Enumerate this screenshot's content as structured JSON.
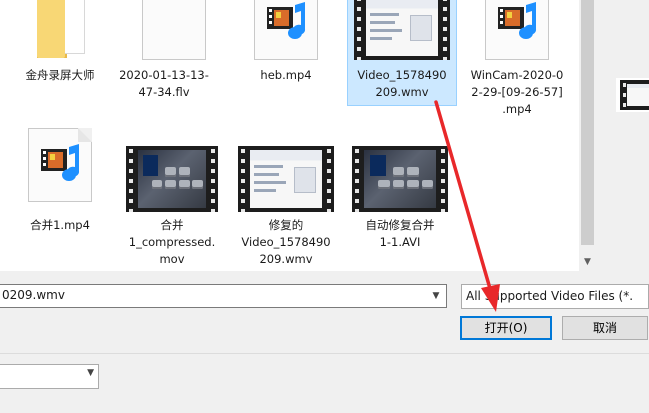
{
  "files": [
    {
      "name": "金舟录屏大师",
      "kind": "folder",
      "selected": false
    },
    {
      "name": "2020-01-13-13-\n47-34.flv",
      "kind": "document",
      "selected": false
    },
    {
      "name": "heb.mp4",
      "kind": "media-file",
      "selected": false
    },
    {
      "name": "Video_1578490\n209.wmv",
      "kind": "video-thumb-app",
      "selected": true
    },
    {
      "name": "WinCam-2020-0\n2-29-[09-26-57]\n.mp4",
      "kind": "media-file",
      "selected": false
    },
    {
      "name": "合并1.mp4",
      "kind": "media-file",
      "selected": false
    },
    {
      "name": "合并\n1_compressed.\nmov",
      "kind": "video-thumb-keys",
      "selected": false
    },
    {
      "name": "修复的\nVideo_1578490\n209.wmv",
      "kind": "video-thumb-app",
      "selected": false
    },
    {
      "name": "自动修复合并\n1-1.AVI",
      "kind": "video-thumb-keys",
      "selected": false
    }
  ],
  "filename_value": "0209.wmv",
  "filetype_selected": "All Supported Video Files (*.",
  "buttons": {
    "open": "打开(O)",
    "cancel": "取消"
  },
  "annotation": {
    "color": "#e8282a"
  },
  "colors": {
    "selection": "#cce8ff",
    "accent": "#0078d7"
  }
}
